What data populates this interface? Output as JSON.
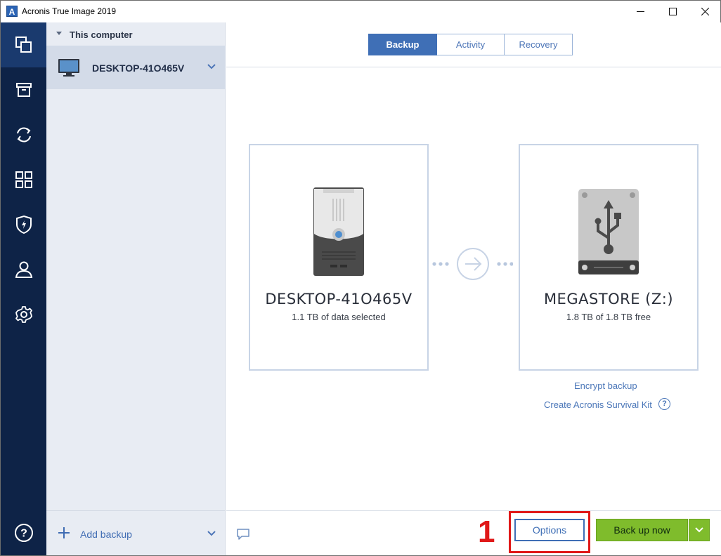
{
  "window": {
    "title": "Acronis True Image 2019",
    "logo_letter": "A"
  },
  "rail": {
    "items": [
      {
        "icon": "backup-copies-icon",
        "active": true
      },
      {
        "icon": "archive-icon",
        "active": false
      },
      {
        "icon": "sync-icon",
        "active": false
      },
      {
        "icon": "tools-grid-icon",
        "active": false
      },
      {
        "icon": "shield-icon",
        "active": false
      },
      {
        "icon": "account-icon",
        "active": false
      },
      {
        "icon": "settings-gear-icon",
        "active": false
      }
    ],
    "help_icon": "help-icon",
    "help_glyph": "?"
  },
  "sidebar": {
    "group_label": "This computer",
    "computer_name": "DESKTOP-41O465V",
    "add_backup_label": "Add backup"
  },
  "tabs": [
    {
      "label": "Backup",
      "active": true
    },
    {
      "label": "Activity",
      "active": false
    },
    {
      "label": "Recovery",
      "active": false
    }
  ],
  "source": {
    "name": "DESKTOP-41O465V",
    "detail": "1.1 TB of data selected"
  },
  "destination": {
    "name": "MEGASTORE (Z:)",
    "detail": "1.8 TB of 1.8 TB free"
  },
  "links": {
    "encrypt": "Encrypt backup",
    "survival_kit": "Create Acronis Survival Kit",
    "help_glyph": "?"
  },
  "footer": {
    "annotation_number": "1",
    "options_label": "Options",
    "backup_now_label": "Back up now"
  },
  "colors": {
    "rail_bg": "#0e2347",
    "accent_blue": "#3f6fb6",
    "backup_green": "#7fbc2c",
    "annotation_red": "#e01818"
  }
}
